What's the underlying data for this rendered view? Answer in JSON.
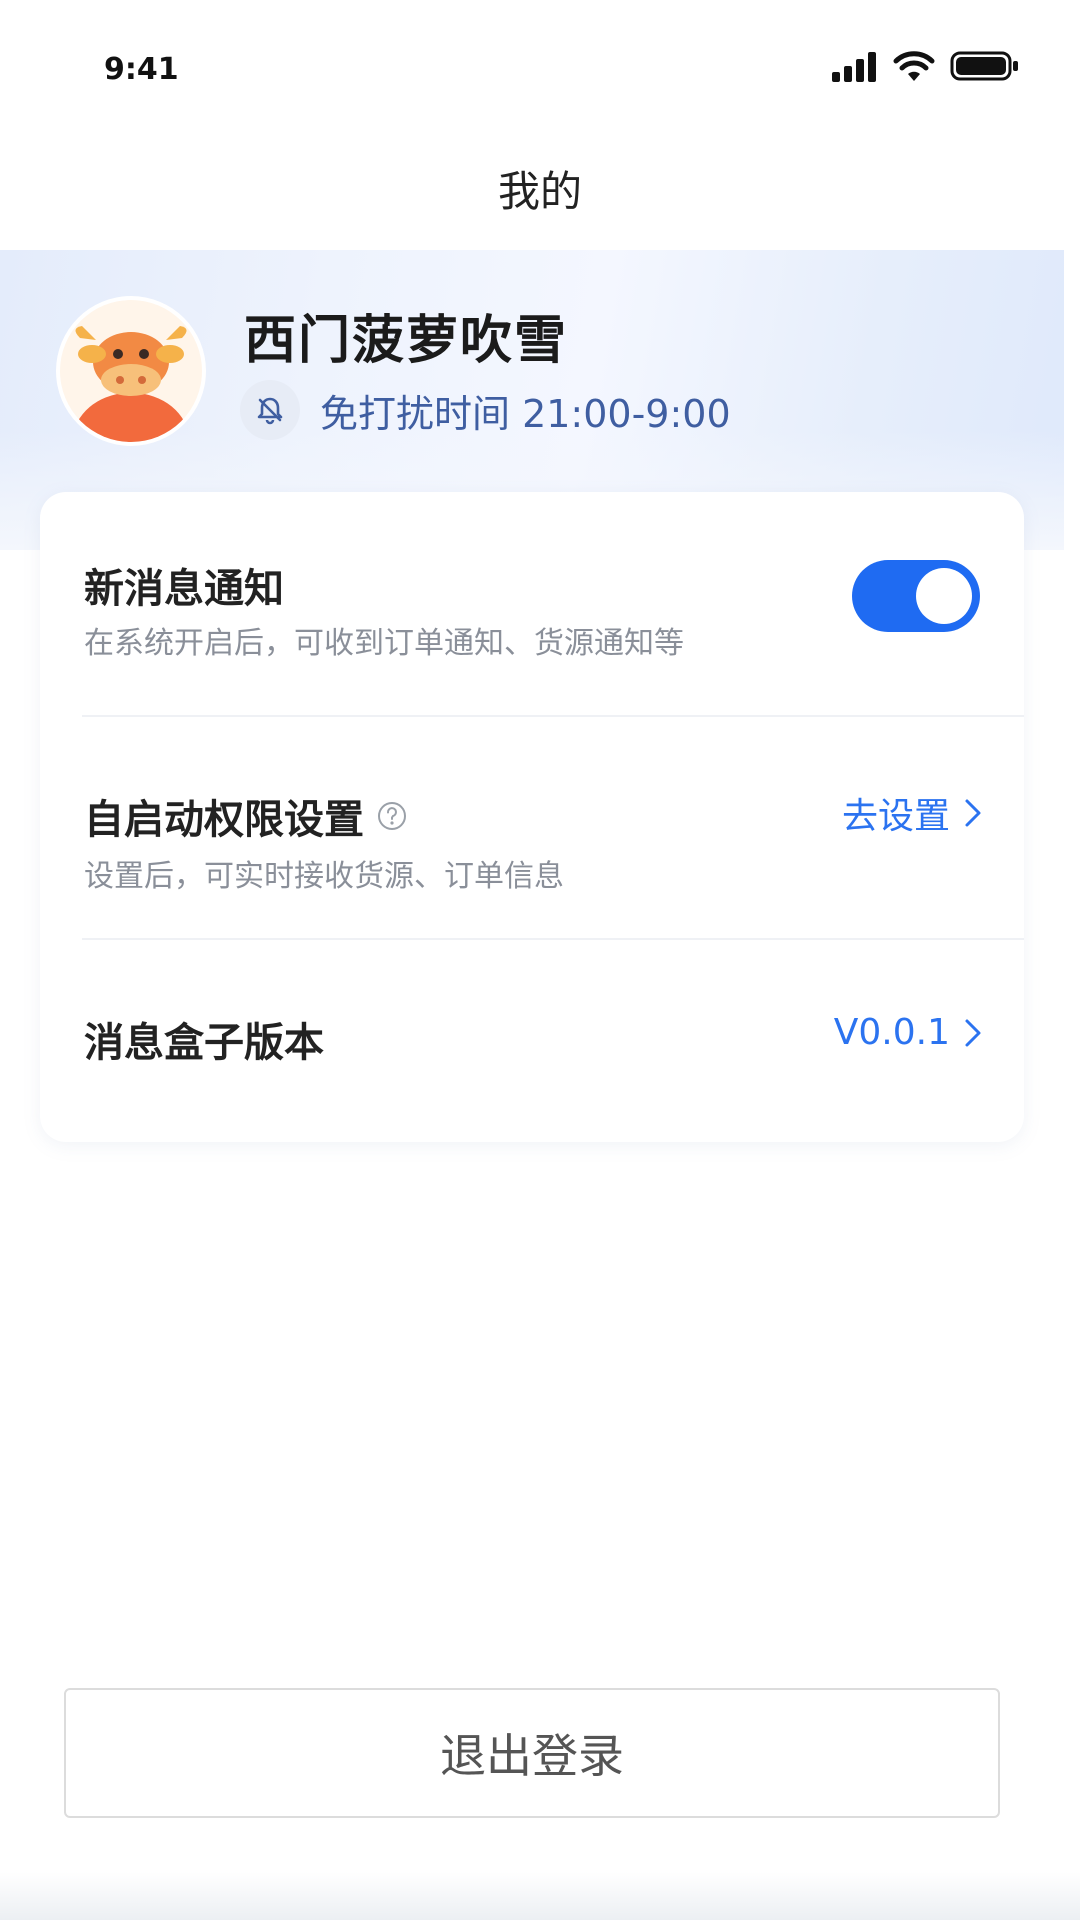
{
  "status_bar": {
    "time": "9:41"
  },
  "nav": {
    "title": "我的"
  },
  "profile": {
    "name": "西门菠萝吹雪",
    "dnd_text": "免打扰时间 21:00-9:00"
  },
  "settings": {
    "notify": {
      "title": "新消息通知",
      "subtitle": "在系统开启后，可收到订单通知、货源通知等",
      "enabled": true
    },
    "autostart": {
      "title": "自启动权限设置",
      "subtitle": "设置后，可实时接收货源、订单信息",
      "action": "去设置"
    },
    "version": {
      "title": "消息盒子版本",
      "value": "V0.0.1"
    }
  },
  "logout": {
    "label": "退出登录"
  },
  "colors": {
    "accent": "#1f6bf2",
    "link": "#2b73f0",
    "dnd_text": "#3f5ea1"
  }
}
